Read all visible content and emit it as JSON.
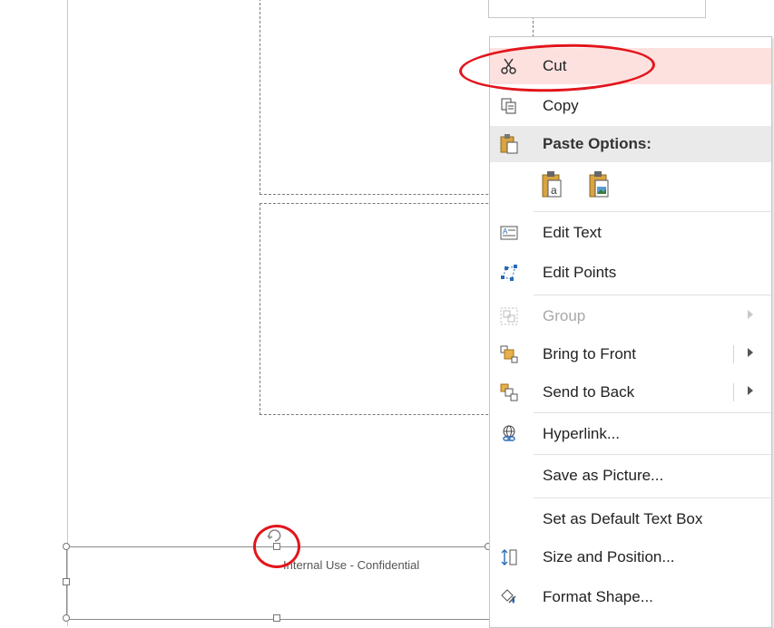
{
  "footer": {
    "text": "Internal Use - Confidential"
  },
  "context_menu": {
    "cut": "Cut",
    "copy": "Copy",
    "paste_header": "Paste Options:",
    "edit_text": "Edit Text",
    "edit_points": "Edit Points",
    "group": "Group",
    "bring_to_front": "Bring to Front",
    "send_to_back": "Send to Back",
    "hyperlink": "Hyperlink...",
    "save_as_picture": "Save as Picture...",
    "set_default_text_box": "Set as Default Text Box",
    "size_and_position": "Size and Position...",
    "format_shape": "Format Shape..."
  },
  "colors": {
    "highlight": "#fde1df",
    "annotation_red": "#e2151c"
  }
}
